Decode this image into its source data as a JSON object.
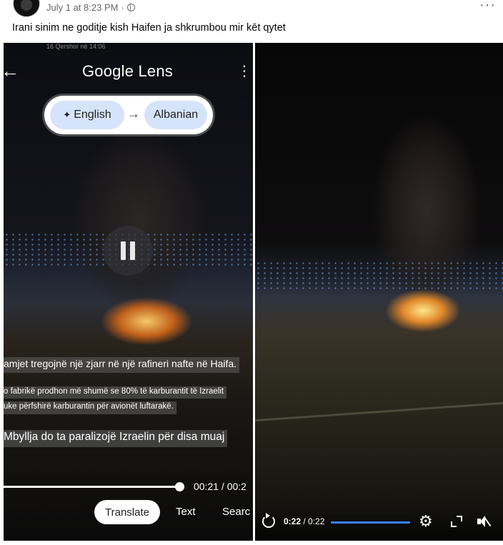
{
  "post": {
    "timestamp": "July 1 at 8:23 PM",
    "privacy_icon": "globe-icon",
    "more_icon": "more-options-icon",
    "caption": "Irani sinim ne goditje kish Haifen ja shkrumbou mir kēt qytet"
  },
  "left_video": {
    "status_time": "16 Qershor në 14:06",
    "app_title": "Google Lens",
    "source_language": "English",
    "target_language": "Albanian",
    "subtitles": [
      "amjet tregojnë një zjarr në një rafineri nafte në Haifa.",
      "o fabrikë prodhon më shumë se 80% të karburantit të Izraelit",
      "uke përfshirë karburantin për avionët luftarakë.",
      "Mbyllja do ta paralizojë Izraelin për disa muaj"
    ],
    "time_display": "00:21 / 00:2",
    "tabs": [
      "Translate",
      "Text",
      "Searc"
    ]
  },
  "right_video": {
    "current_time": "0:22",
    "total_time": "/ 0:22",
    "progress": 1.0,
    "accent_color": "#3b82f6"
  }
}
